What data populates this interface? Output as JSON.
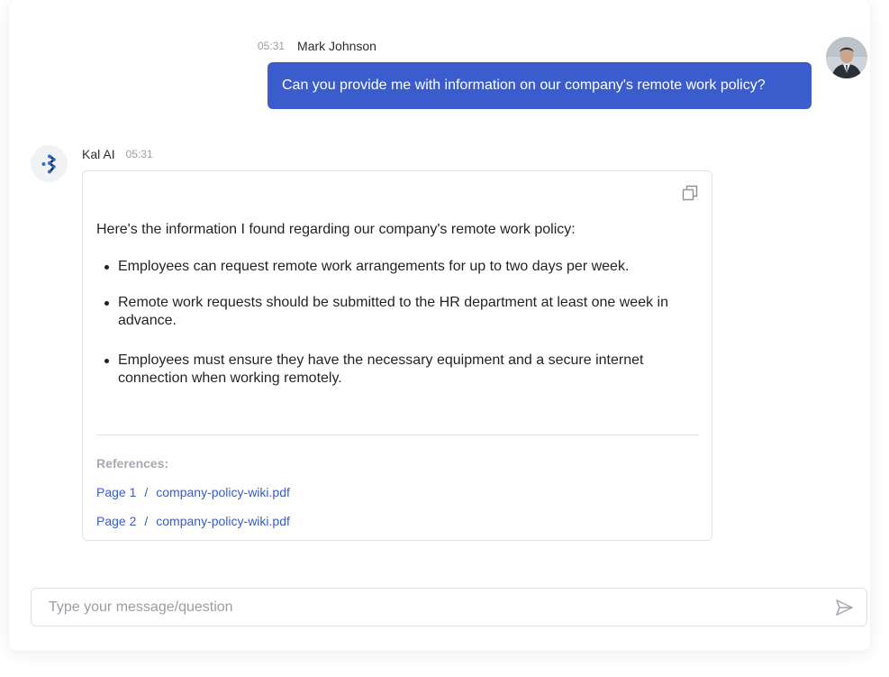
{
  "user_message": {
    "time": "05:31",
    "sender": "Mark Johnson",
    "text": "Can you provide me with information on our company's remote work policy?"
  },
  "ai_message": {
    "sender": "Kal AI",
    "time": "05:31",
    "intro": "Here's the information I found regarding our company's remote work policy:",
    "bullets": [
      "Employees can request remote work arrangements for up to two days per week.",
      "Remote work requests should be submitted to the HR department at least one week in advance.",
      "Employees must ensure they have the necessary equipment and a secure internet connection when working remotely."
    ],
    "references_title": "References:",
    "references": [
      {
        "page": "Page 1",
        "separator": "/",
        "file": "company-policy-wiki.pdf"
      },
      {
        "page": "Page 2",
        "separator": "/",
        "file": "company-policy-wiki.pdf"
      }
    ]
  },
  "composer": {
    "placeholder": "Type your message/question",
    "value": ""
  },
  "icons": {
    "copy": "copy-icon",
    "send": "send-icon",
    "ai_logo": "kal-ai-logo-icon",
    "avatar": "user-avatar"
  },
  "colors": {
    "accent": "#3a5ccc",
    "muted": "#9a9ea4"
  }
}
